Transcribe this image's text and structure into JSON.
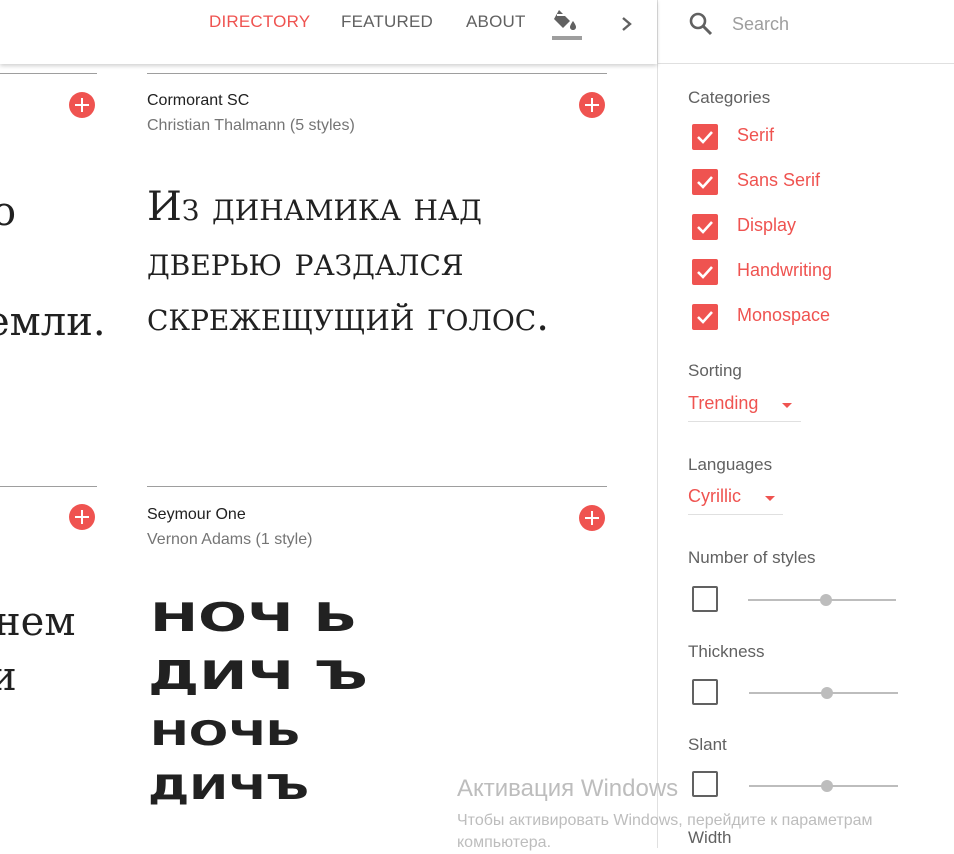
{
  "header": {
    "nav": [
      "DIRECTORY",
      "FEATURED",
      "ABOUT"
    ]
  },
  "search": {
    "placeholder": "Search"
  },
  "sidebar": {
    "categories_label": "Categories",
    "categories": [
      "Serif",
      "Sans Serif",
      "Display",
      "Handwriting",
      "Monospace"
    ],
    "sorting_label": "Sorting",
    "sorting_value": "Trending",
    "languages_label": "Languages",
    "languages_value": "Cyrillic",
    "number_of_styles_label": "Number of styles",
    "thickness_label": "Thickness",
    "slant_label": "Slant",
    "width_label": "Width"
  },
  "cards": {
    "left_top_sample": [
      "о",
      "емли."
    ],
    "left_bottom_sample": [
      "нем",
      "и"
    ],
    "cormorant": {
      "name": "Cormorant SC",
      "author": "Christian Thalmann (5 styles)",
      "sample": "Из динамика над дверью раздался скрежещущий голос."
    },
    "seymour": {
      "name": "Seymour One",
      "author": "Vernon Adams (1 style)",
      "sample_lines": [
        "НОЧ Ь",
        "ДИЧ Ъ",
        "НОЧЬ",
        "ДИЧЪ"
      ]
    }
  },
  "watermark": {
    "title": "Активация Windows",
    "subtitle_line1": "Чтобы активировать Windows, перейдите к параметрам",
    "subtitle_line2": "компьютера."
  },
  "colors": {
    "accent": "#ef5350",
    "text": "#212121",
    "muted": "#616161"
  }
}
